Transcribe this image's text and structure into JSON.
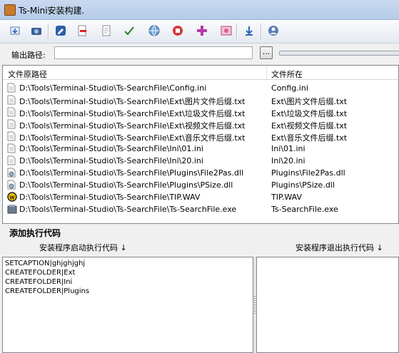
{
  "window": {
    "title": "Ts-Mini安装构建."
  },
  "toolbar": {
    "buttons": [
      {
        "icon": "open-project-icon"
      },
      {
        "icon": "camera-icon"
      },
      {
        "icon": "edit-icon"
      },
      {
        "icon": "remove-file-icon"
      },
      {
        "icon": "document-icon"
      },
      {
        "icon": "check-icon"
      },
      {
        "icon": "globe-icon"
      },
      {
        "icon": "stop-icon"
      },
      {
        "icon": "add-icon"
      },
      {
        "icon": "image-icon"
      },
      {
        "icon": "download-arrow-icon"
      },
      {
        "icon": "about-icon"
      }
    ]
  },
  "output": {
    "label": "输出路径:",
    "value": "",
    "browse_label": "..."
  },
  "filelist": {
    "headers": {
      "source": "文件原路径",
      "target": "文件所在"
    },
    "rows": [
      {
        "source": "D:\\Tools\\Terminal-Studio\\Ts-SearchFile\\Config.ini",
        "target": "Config.ini",
        "icon": "ini-file-icon"
      },
      {
        "source": "D:\\Tools\\Terminal-Studio\\Ts-SearchFile\\Ext\\图片文件后缀.txt",
        "target": "Ext\\图片文件后缀.txt",
        "icon": "text-file-icon"
      },
      {
        "source": "D:\\Tools\\Terminal-Studio\\Ts-SearchFile\\Ext\\垃圾文件后缀.txt",
        "target": "Ext\\垃圾文件后缀.txt",
        "icon": "text-file-icon"
      },
      {
        "source": "D:\\Tools\\Terminal-Studio\\Ts-SearchFile\\Ext\\视频文件后缀.txt",
        "target": "Ext\\视频文件后缀.txt",
        "icon": "text-file-icon"
      },
      {
        "source": "D:\\Tools\\Terminal-Studio\\Ts-SearchFile\\Ext\\音乐文件后缀.txt",
        "target": "Ext\\音乐文件后缀.txt",
        "icon": "text-file-icon"
      },
      {
        "source": "D:\\Tools\\Terminal-Studio\\Ts-SearchFile\\Ini\\01.ini",
        "target": "Ini\\01.ini",
        "icon": "ini-file-icon"
      },
      {
        "source": "D:\\Tools\\Terminal-Studio\\Ts-SearchFile\\Ini\\20.ini",
        "target": "Ini\\20.ini",
        "icon": "ini-file-icon"
      },
      {
        "source": "D:\\Tools\\Terminal-Studio\\Ts-SearchFile\\Plugins\\File2Pas.dll",
        "target": "Plugins\\File2Pas.dll",
        "icon": "dll-file-icon"
      },
      {
        "source": "D:\\Tools\\Terminal-Studio\\Ts-SearchFile\\Plugins\\PSize.dll",
        "target": "Plugins\\PSize.dll",
        "icon": "dll-file-icon"
      },
      {
        "source": "D:\\Tools\\Terminal-Studio\\Ts-SearchFile\\TIP.WAV",
        "target": "TIP.WAV",
        "icon": "audio-file-icon"
      },
      {
        "source": "D:\\Tools\\Terminal-Studio\\Ts-SearchFile\\Ts-SearchFile.exe",
        "target": "Ts-SearchFile.exe",
        "icon": "exe-file-icon"
      }
    ]
  },
  "code": {
    "section_title": "添加执行代码",
    "startup_header": "安装程序启动执行代码 ↓",
    "exit_header": "安装程序退出执行代码 ↓",
    "startup_code": "SETCAPTION|ghjghjghj\nCREATEFOLDER|Ext\nCREATEFOLDER|Ini\nCREATEFOLDER|Plugins",
    "exit_code": ""
  }
}
